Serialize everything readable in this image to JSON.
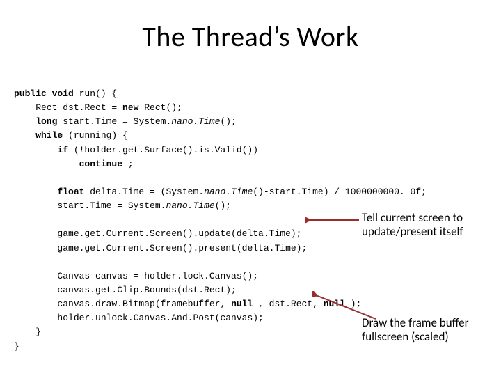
{
  "title": "The Thread’s Work",
  "code": {
    "l1_kw1": "public void",
    "l1_rest": " run() {",
    "l2a": "    Rect dst.Rect = ",
    "l2_kw": "new",
    "l2b": " Rect();",
    "l3_kw": "    long",
    "l3_rest": " start.Time = System.",
    "l3_it": "nano.Time",
    "l3_end": "();",
    "l4_kw": "    while",
    "l4_rest": " (running) {",
    "l5_kw": "        if",
    "l5_rest": " (!holder.get.Surface().is.Valid())",
    "l6_kw": "            continue",
    "l6_rest": " ;",
    "blank1": "",
    "l7_kw": "        float",
    "l7a": " delta.Time = (System.",
    "l7_it1": "nano.Time",
    "l7b": "()-start.Time) / 1000000000. 0f;",
    "l8a": "        start.Time = System.",
    "l8_it": "nano.Time",
    "l8b": "();",
    "blank2": "",
    "l9": "        game.get.Current.Screen().update(delta.Time);",
    "l10": "        game.get.Current.Screen().present(delta.Time);",
    "blank3": "",
    "l11": "        Canvas canvas = holder.lock.Canvas();",
    "l12": "        canvas.get.Clip.Bounds(dst.Rect);",
    "l13a": "        canvas.draw.Bitmap(framebuffer, ",
    "l13_kw1": "null",
    "l13b": " , dst.Rect, ",
    "l13_kw2": "null",
    "l13c": " );",
    "l14": "        holder.unlock.Canvas.And.Post(canvas);",
    "l15": "    }",
    "l16": "}"
  },
  "annotations": {
    "a1_line1": "Tell current screen to",
    "a1_line2": "update/present itself",
    "a2_line1": "Draw the frame buffer",
    "a2_line2": "fullscreen (scaled)"
  }
}
